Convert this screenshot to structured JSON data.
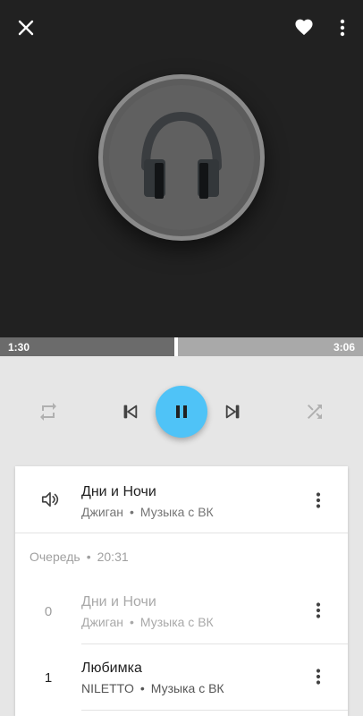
{
  "player": {
    "icons": {
      "close": "close-icon",
      "favorite": "heart-icon",
      "more": "more-vertical-icon",
      "artwork": "headphones-icon"
    },
    "progress": {
      "current_time": "1:30",
      "total_time": "3:06",
      "fraction": 0.484
    },
    "controls": {
      "repeat": "repeat-icon",
      "previous": "skip-previous-icon",
      "play_pause": "pause-icon",
      "next": "skip-next-icon",
      "shuffle": "shuffle-icon"
    },
    "colors": {
      "accent": "#4fc3f7",
      "artwork_background": "#212121",
      "panel_background": "#e6e6e6"
    }
  },
  "now_playing": {
    "title": "Дни и Ночи",
    "artist": "Джиган",
    "source": "Музыка с ВК",
    "separator": "•",
    "icon": "volume-icon"
  },
  "queue": {
    "label": "Очередь",
    "separator": "•",
    "duration": "20:31",
    "items": [
      {
        "index": "0",
        "title": "Дни и Ночи",
        "artist": "Джиган",
        "source": "Музыка с ВК",
        "played": true
      },
      {
        "index": "1",
        "title": "Любимка",
        "artist": "NILETTO",
        "source": "Музыка с ВК",
        "played": false
      }
    ]
  }
}
